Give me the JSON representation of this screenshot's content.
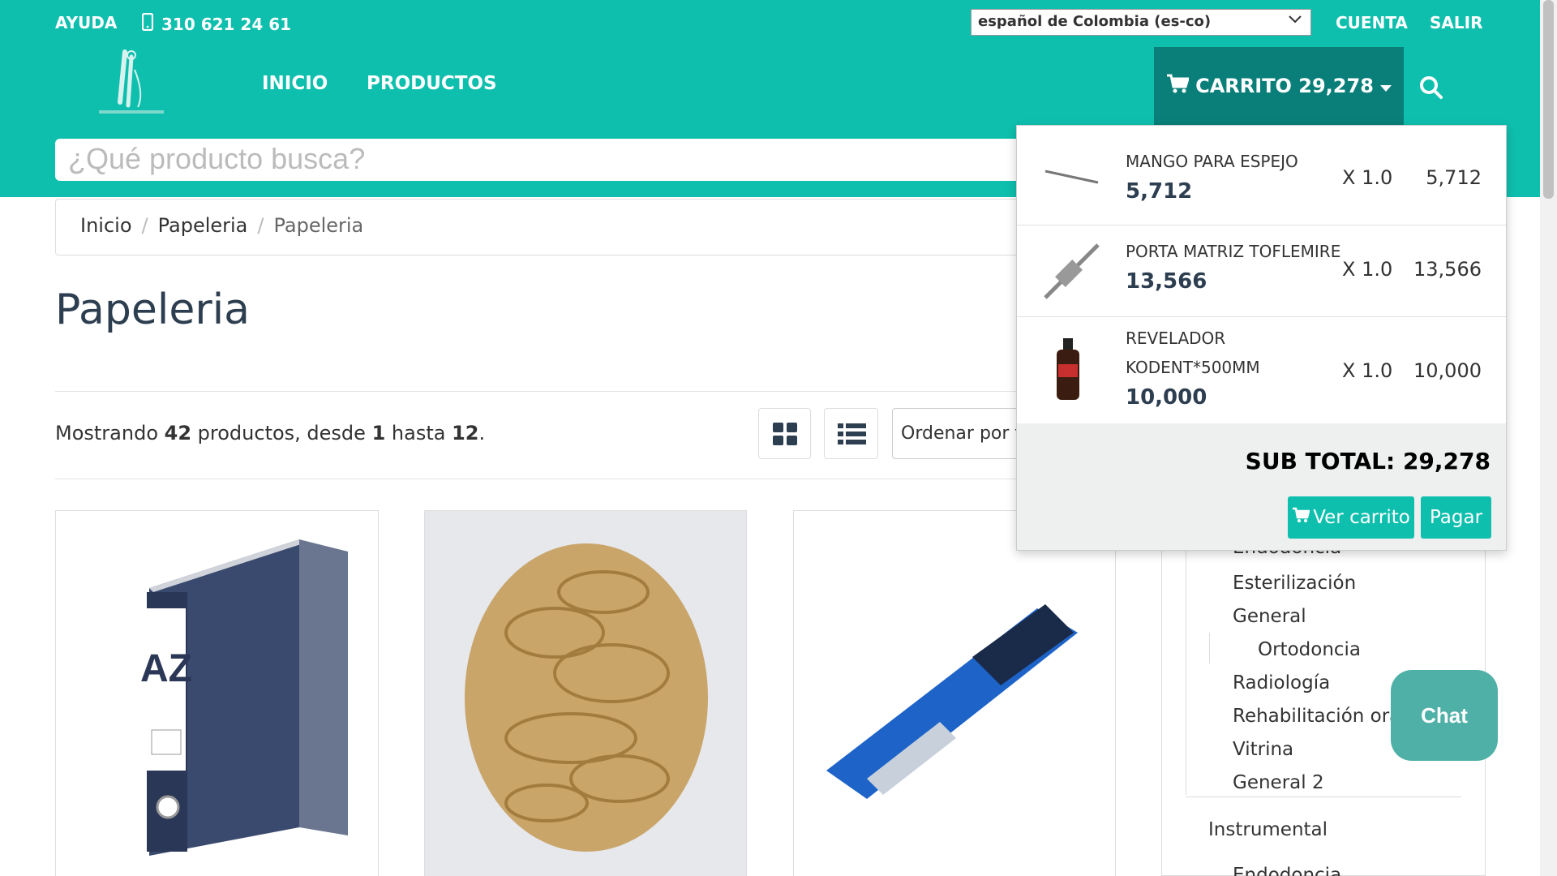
{
  "topbar": {
    "help": "AYUDA",
    "phone": "310 621 24 61",
    "language": "español de Colombia (es-co)",
    "account": "CUENTA",
    "logout": "SALIR"
  },
  "nav": {
    "home": "INICIO",
    "products": "PRODUCTOS",
    "cart_label": "CARRITO 29,278"
  },
  "search": {
    "placeholder": "¿Qué producto busca?"
  },
  "breadcrumb": [
    "Inicio",
    "Papeleria",
    "Papeleria"
  ],
  "page": {
    "title": "Papeleria",
    "showing_prefix": "Mostrando ",
    "count": "42",
    "showing_mid": " productos, desde ",
    "from": "1",
    "showing_mid2": " hasta ",
    "to": "12",
    "showing_end": ".",
    "sort_label": "Ordenar por fe"
  },
  "sidebar": {
    "items": [
      "Endodoncia",
      "Esterilización",
      "General",
      "Ortodoncia",
      "Radiología",
      "Rehabilitación oral",
      "Vitrina",
      "General 2"
    ],
    "section": "Instrumental",
    "next_item": "Endodoncia"
  },
  "cart": {
    "items": [
      {
        "name": "MANGO PARA ESPEJO",
        "price": "5,712",
        "qty": "X 1.0",
        "total": "5,712"
      },
      {
        "name": "PORTA MATRIZ TOFLEMIRE",
        "price": "13,566",
        "qty": "X 1.0",
        "total": "13,566"
      },
      {
        "name_line1": "REVELADOR",
        "name_line2": "KODENT*500MM",
        "price": "10,000",
        "qty": "X 1.0",
        "total": "10,000"
      }
    ],
    "subtotal": "SUB TOTAL: 29,278",
    "view_cart": "Ver carrito",
    "pay": "Pagar"
  },
  "chat": {
    "label": "Chat"
  },
  "colors": {
    "brand": "#0fbfae",
    "cart_dark": "#0a7f7a",
    "chat": "#4fb0a7",
    "title": "#2d3e50"
  }
}
